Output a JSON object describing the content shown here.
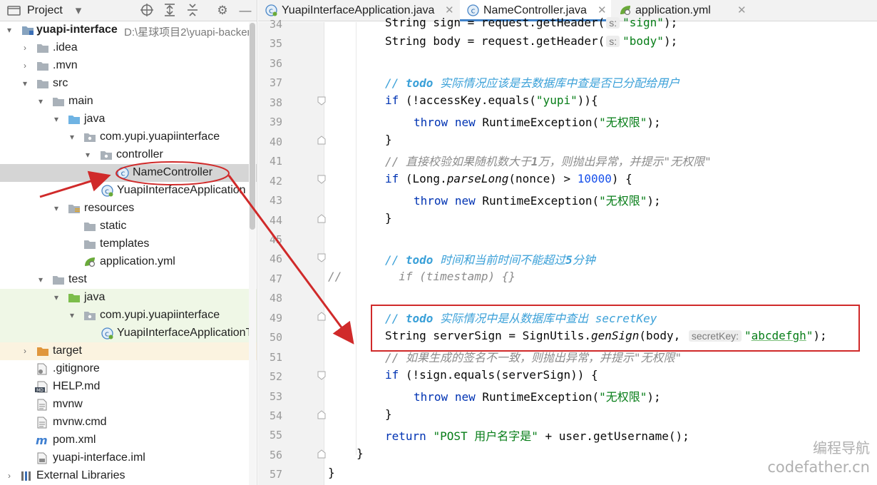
{
  "project_panel": {
    "title": "Project",
    "toolbar_icons": [
      "target-icon",
      "expand-all-icon",
      "collapse-all-icon",
      "gear-icon",
      "minimize-icon"
    ],
    "tree": [
      {
        "label": "yuapi-interface",
        "path": "D:\\星球项目2\\yuapi-backen",
        "bold": true,
        "expanded": true,
        "icon": "module-folder-icon"
      },
      {
        "label": ".idea",
        "expanded": false,
        "icon": "folder-icon"
      },
      {
        "label": ".mvn",
        "expanded": false,
        "icon": "folder-icon"
      },
      {
        "label": "src",
        "expanded": true,
        "icon": "folder-icon"
      },
      {
        "label": "main",
        "expanded": true,
        "icon": "folder-icon"
      },
      {
        "label": "java",
        "expanded": true,
        "icon": "source-folder-icon"
      },
      {
        "label": "com.yupi.yuapiinterface",
        "expanded": true,
        "icon": "package-icon"
      },
      {
        "label": "controller",
        "expanded": true,
        "icon": "package-icon"
      },
      {
        "label": "NameController",
        "selected": true,
        "icon": "java-class-icon"
      },
      {
        "label": "YuapiInterfaceApplication",
        "icon": "spring-class-icon"
      },
      {
        "label": "resources",
        "expanded": true,
        "icon": "resources-folder-icon"
      },
      {
        "label": "static",
        "icon": "folder-icon"
      },
      {
        "label": "templates",
        "icon": "folder-icon"
      },
      {
        "label": "application.yml",
        "icon": "yaml-icon"
      },
      {
        "label": "test",
        "expanded": true,
        "icon": "folder-icon"
      },
      {
        "label": "java",
        "expanded": true,
        "icon": "test-source-folder-icon"
      },
      {
        "label": "com.yupi.yuapiinterface",
        "expanded": true,
        "icon": "package-icon"
      },
      {
        "label": "YuapiInterfaceApplicationT",
        "icon": "spring-class-icon"
      },
      {
        "label": "target",
        "expanded": false,
        "icon": "excluded-folder-icon"
      },
      {
        "label": ".gitignore",
        "icon": "gitignore-icon"
      },
      {
        "label": "HELP.md",
        "icon": "markdown-icon"
      },
      {
        "label": "mvnw",
        "icon": "text-file-icon"
      },
      {
        "label": "mvnw.cmd",
        "icon": "text-file-icon"
      },
      {
        "label": "pom.xml",
        "icon": "maven-icon"
      },
      {
        "label": "yuapi-interface.iml",
        "icon": "iml-icon"
      },
      {
        "label": "External Libraries",
        "expanded": false,
        "icon": "libraries-icon"
      }
    ]
  },
  "tabs": [
    {
      "label": "YuapiInterfaceApplication.java",
      "active": false,
      "icon": "spring-class-icon"
    },
    {
      "label": "NameController.java",
      "active": true,
      "icon": "java-class-icon"
    },
    {
      "label": "application.yml",
      "active": false,
      "icon": "yaml-icon"
    }
  ],
  "editor": {
    "line_numbers": [
      "34",
      "35",
      "36",
      "37",
      "38",
      "39",
      "40",
      "41",
      "42",
      "43",
      "44",
      "45",
      "46",
      "47",
      "48",
      "49",
      "50",
      "51",
      "52",
      "53",
      "54",
      "55",
      "56",
      "57"
    ],
    "code": {
      "l34": {
        "a": "String sign = request.getHeader(",
        "hint": "s:",
        "str": "\"sign\"",
        "b": ");"
      },
      "l35": {
        "a": "String body = request.getHeader(",
        "hint": "s:",
        "str": "\"body\"",
        "b": ");"
      },
      "l37": {
        "slash": "// ",
        "todo": "todo",
        "text": " 实际情况应该是去数据库中查是否已分配给用户"
      },
      "l38": {
        "kw": "if",
        "a": " (!accessKey.equals(",
        "str": "\"yupi\"",
        "b": ")){"
      },
      "l39": {
        "kw1": "throw",
        "kw2": "new",
        "a": " RuntimeException(",
        "str": "\"无权限\"",
        "b": ");"
      },
      "l40": {
        "a": "}"
      },
      "l41": {
        "a": "// 直接校验如果随机数大于",
        "num": "1",
        "b": "万，则抛出异常，并提示\"无权限\""
      },
      "l42": {
        "kw": "if",
        "a": " (Long.",
        "it": "parseLong",
        "b": "(nonce) > ",
        "num": "10000",
        "c": ") {"
      },
      "l43": {
        "kw1": "throw",
        "kw2": "new",
        "a": " RuntimeException(",
        "str": "\"无权限\"",
        "b": ");"
      },
      "l44": {
        "a": "}"
      },
      "l46": {
        "slash": "// ",
        "todo": "todo",
        "text": " 时间和当前时间不能超过",
        "num": "5",
        "text2": "分钟"
      },
      "l47": {
        "slash": "//",
        "a": "if (timestamp) {}"
      },
      "l49": {
        "slash": "// ",
        "todo": "todo",
        "text": " 实际情况中是从数据库中查出 ",
        "ident": "secretKey"
      },
      "l50": {
        "a": "String serverSign = SignUtils.",
        "it": "genSign",
        "b": "(body, ",
        "hint": "secretKey:",
        "str_q1": "\"",
        "str_body": "abcdefgh",
        "str_q2": "\"",
        "c": ");"
      },
      "l51": {
        "a": "// 如果生成的签名不一致，则抛出异常，并提示\"无权限\""
      },
      "l52": {
        "kw": "if",
        "a": " (!sign.equals(serverSign)) {"
      },
      "l53": {
        "kw1": "throw",
        "kw2": "new",
        "a": " RuntimeException(",
        "str": "\"无权限\"",
        "b": ");"
      },
      "l54": {
        "a": "}"
      },
      "l55": {
        "kw": "return",
        "str": "\"POST 用户名字是\"",
        "a": " + user.getUsername();"
      },
      "l56": {
        "a": "}"
      },
      "l57": {
        "a": "}"
      }
    }
  },
  "watermark": {
    "line1": "编程导航",
    "line2": "codefather.cn"
  },
  "colors": {
    "keyword": "#0033b3",
    "string": "#067d17",
    "number": "#1750eb",
    "comment": "#8c8c8c",
    "todo": "#3aa0d8",
    "annotation": "#d02a2a",
    "selection": "#d5d5d5"
  }
}
